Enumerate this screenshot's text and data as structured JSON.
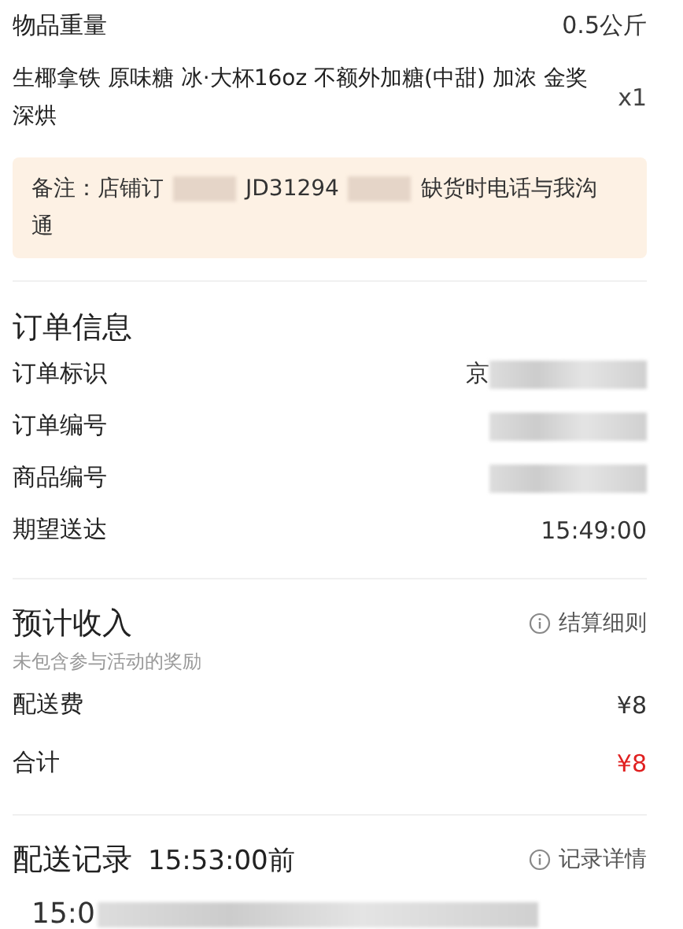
{
  "weight": {
    "label": "物品重量",
    "value": "0.5公斤"
  },
  "item": {
    "name": "生椰拿铁 原味糖 冰·大杯16oz 不额外加糖(中甜) 加浓 金奖深烘",
    "qty": "x1"
  },
  "note": {
    "parts": [
      {
        "kind": "text",
        "text": "备注：店铺订"
      },
      {
        "kind": "redacted"
      },
      {
        "kind": "text",
        "text": "JD31294"
      },
      {
        "kind": "redacted"
      },
      {
        "kind": "text",
        "text": "缺货时电话与我沟"
      },
      {
        "kind": "text",
        "text": "通"
      }
    ]
  },
  "order_info": {
    "title": "订单信息",
    "rows": [
      {
        "label": "订单标识",
        "value": [
          {
            "kind": "text",
            "text": "京"
          },
          {
            "kind": "redacted"
          }
        ]
      },
      {
        "label": "订单编号",
        "value": [
          {
            "kind": "redacted"
          }
        ]
      },
      {
        "label": "商品编号",
        "value": [
          {
            "kind": "redacted"
          }
        ]
      },
      {
        "label": "期望送达",
        "value": [
          {
            "kind": "text",
            "text": "15:49:00"
          }
        ]
      }
    ]
  },
  "income": {
    "title": "预计收入",
    "subtitle": "未包含参与活动的奖励",
    "link": "结算细则",
    "rows": [
      {
        "label": "配送费",
        "value": "¥8",
        "highlight": false
      },
      {
        "label": "合计",
        "value": "¥8",
        "highlight": true
      }
    ]
  },
  "delivery": {
    "title": "配送记录",
    "time": "15:53:00前",
    "link": "记录详情",
    "entry": [
      {
        "kind": "text",
        "text": "15:0"
      },
      {
        "kind": "redacted"
      }
    ]
  }
}
